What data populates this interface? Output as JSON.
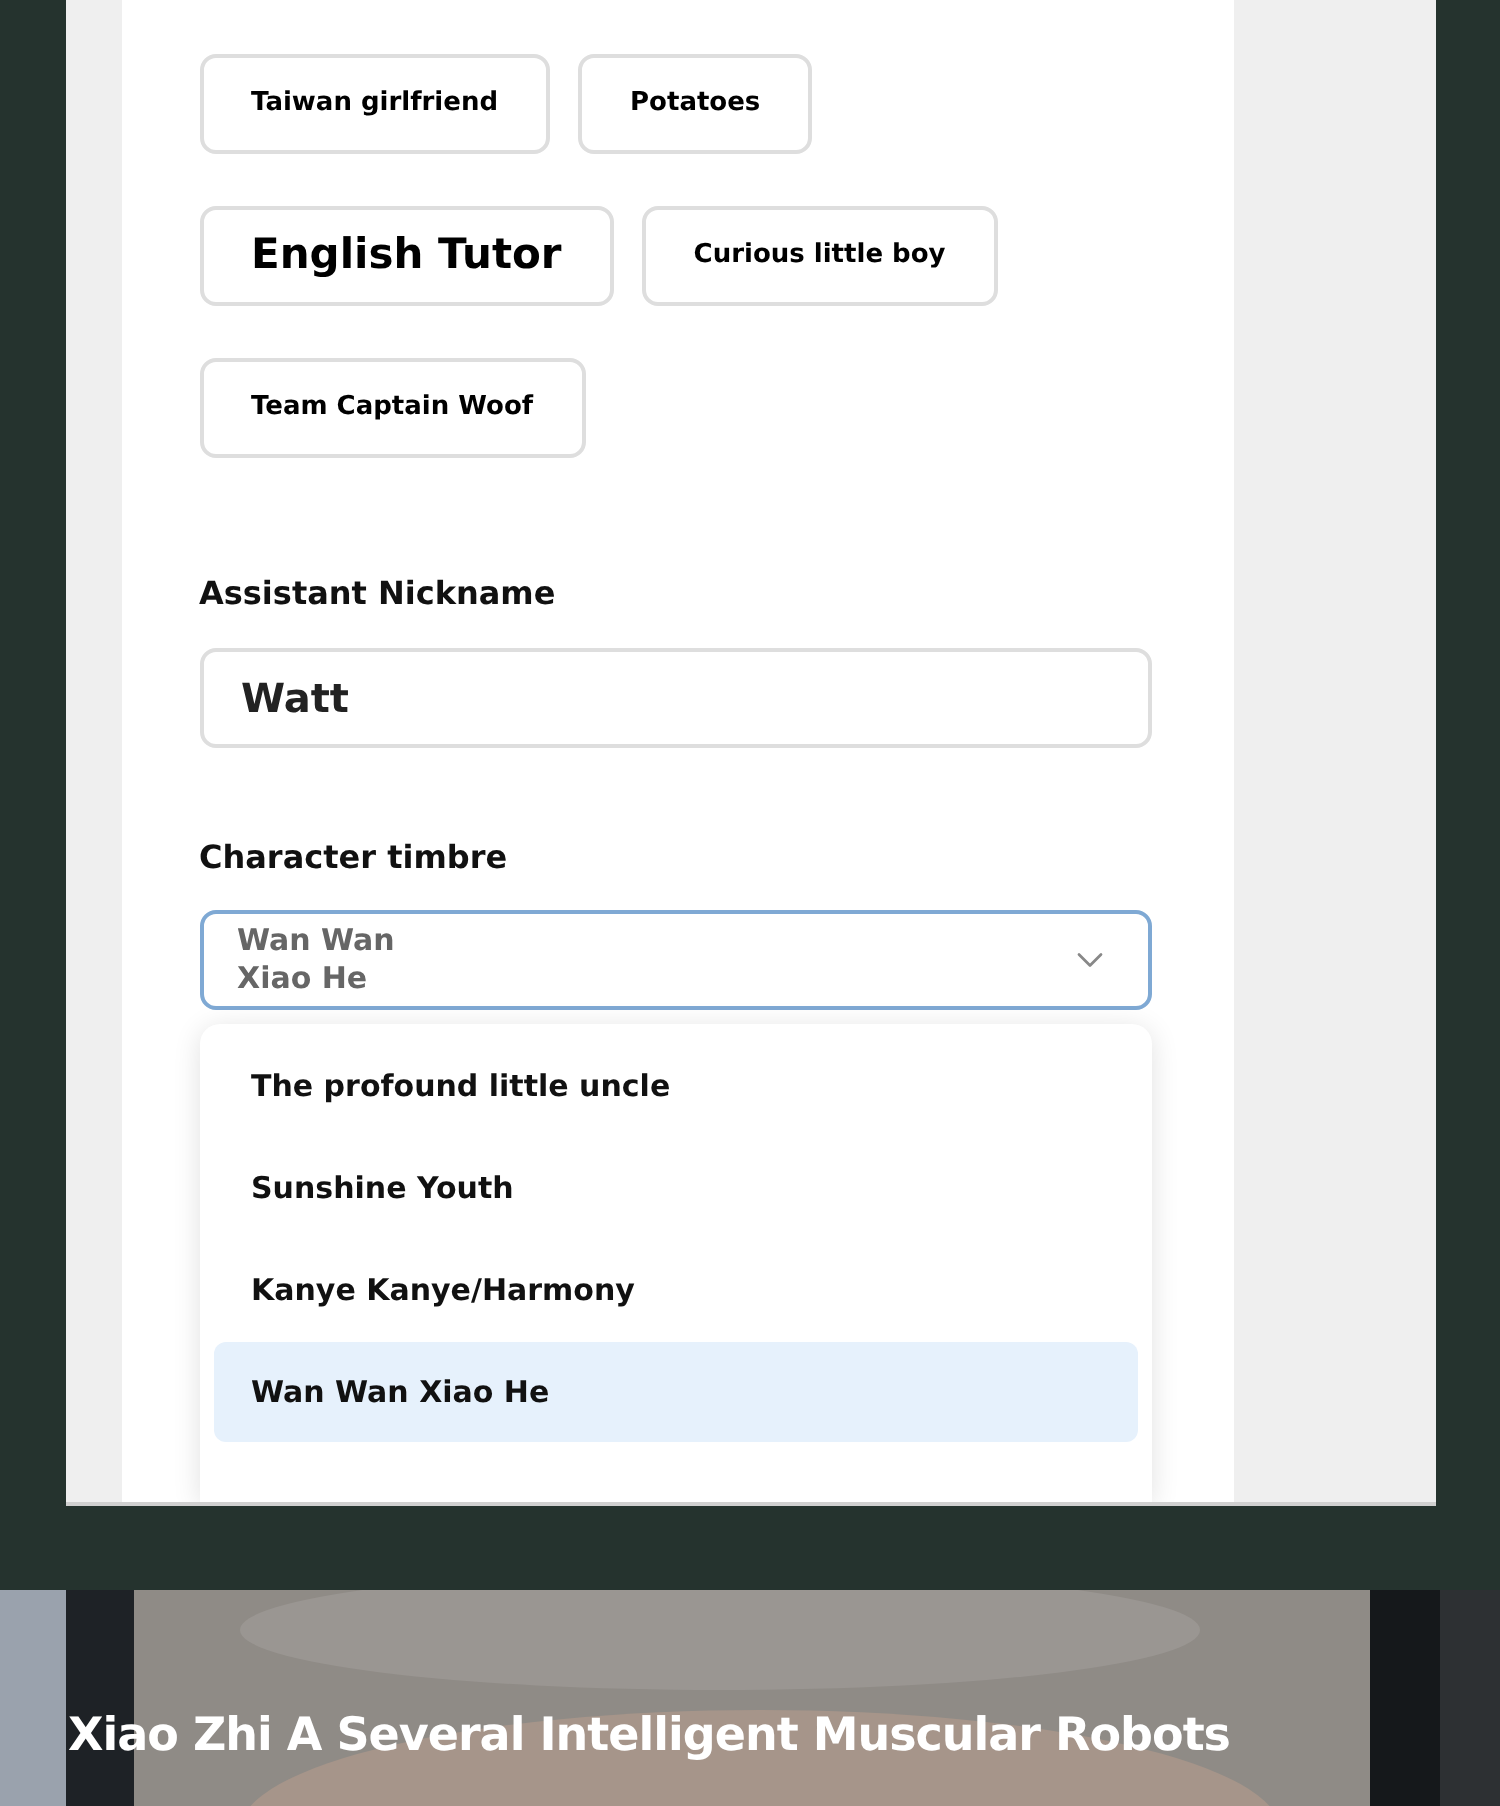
{
  "templates": [
    {
      "label": "Taiwan girlfriend",
      "kind": "small"
    },
    {
      "label": "Potatoes",
      "kind": "small"
    },
    {
      "label": "English Tutor",
      "kind": "large"
    },
    {
      "label": "Curious little boy",
      "kind": "small"
    },
    {
      "label": "Team Captain Woof",
      "kind": "small"
    }
  ],
  "nickname": {
    "label": "Assistant Nickname",
    "value": "Watt"
  },
  "timbre": {
    "label": "Character timbre",
    "value_lines": [
      "Wan Wan",
      "Xiao He"
    ],
    "expanded": true,
    "options": [
      {
        "label": "The profound little uncle",
        "selected": false
      },
      {
        "label": "Sunshine Youth",
        "selected": false
      },
      {
        "label": "Kanye Kanye/Harmony",
        "selected": false
      },
      {
        "label": "Wan Wan Xiao He",
        "selected": true
      }
    ]
  },
  "banner": {
    "kind": "picture",
    "caption": "Xiao Zhi A Several Intelligent Muscular Robots"
  }
}
